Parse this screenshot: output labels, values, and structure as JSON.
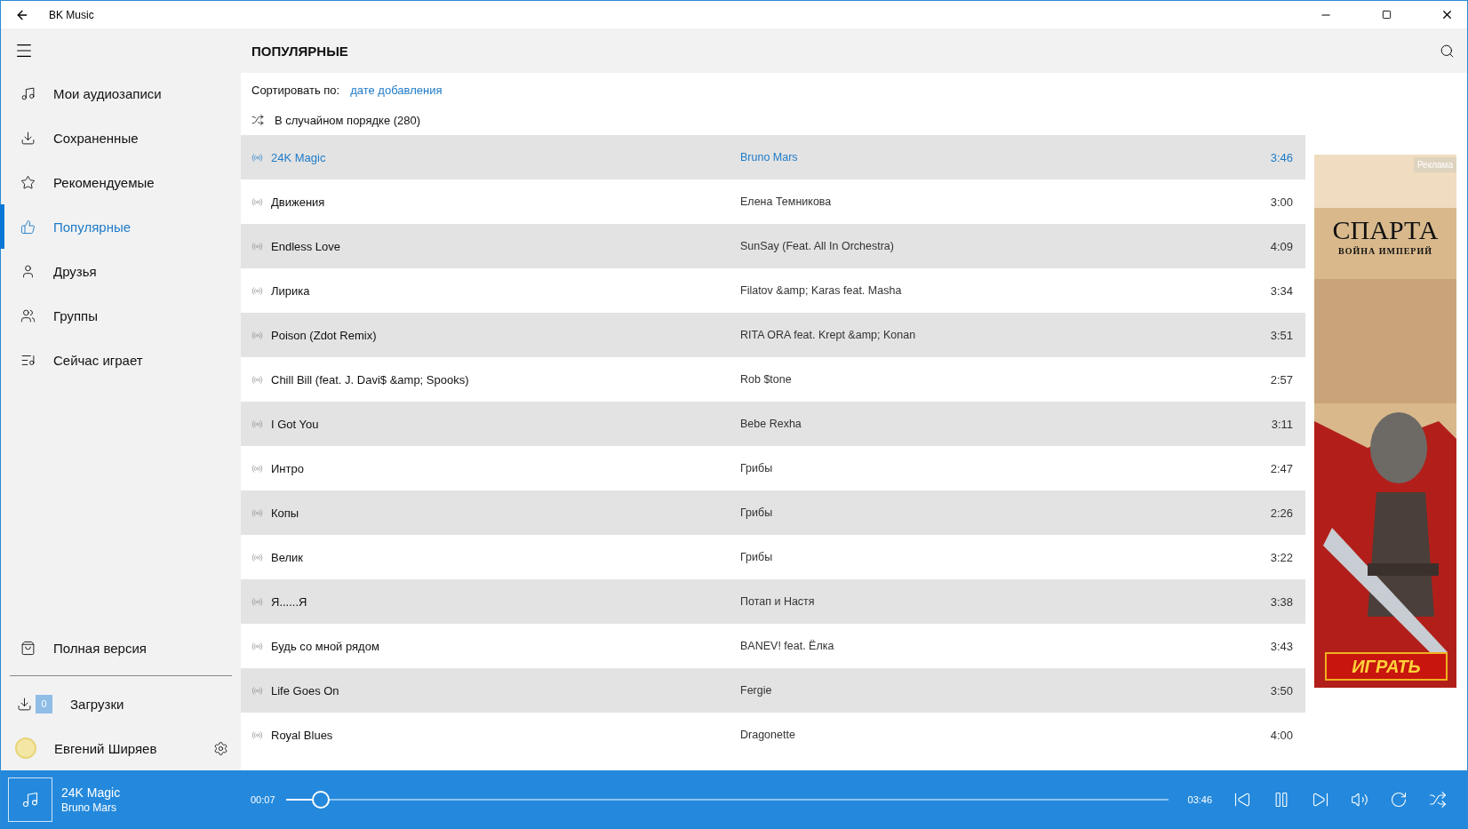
{
  "window": {
    "title": "BK Music"
  },
  "sidebar": {
    "items": [
      {
        "label": "Мои аудиозаписи",
        "kind": "music",
        "selected": false
      },
      {
        "label": "Сохраненные",
        "kind": "download",
        "selected": false
      },
      {
        "label": "Рекомендуемые",
        "kind": "star",
        "selected": false
      },
      {
        "label": "Популярные",
        "kind": "like",
        "selected": true
      },
      {
        "label": "Друзья",
        "kind": "user",
        "selected": false
      },
      {
        "label": "Группы",
        "kind": "group",
        "selected": false
      },
      {
        "label": "Сейчас играет",
        "kind": "queue",
        "selected": false
      }
    ],
    "full_version": "Полная версия",
    "downloads": {
      "count": "0",
      "label": "Загрузки"
    },
    "user": {
      "name": "Евгений Ширяев"
    }
  },
  "header": {
    "title": "ПОПУЛЯРНЫЕ"
  },
  "sort": {
    "label": "Сортировать по:",
    "value": "дате добавления"
  },
  "shuffle": {
    "label": "В случайном порядке (280)"
  },
  "tracks": [
    {
      "title": "24K Magic",
      "artist": "Bruno Mars",
      "duration": "3:46",
      "selected": true
    },
    {
      "title": "Движения",
      "artist": "Елена Темникова",
      "duration": "3:00",
      "selected": false
    },
    {
      "title": "Endless Love",
      "artist": "SunSay (Feat. All In Orchestra)",
      "duration": "4:09",
      "selected": false
    },
    {
      "title": "Лирика",
      "artist": "Filatov &amp; Karas feat. Masha",
      "duration": "3:34",
      "selected": false
    },
    {
      "title": "Poison (Zdot Remix)",
      "artist": "RITA ORA feat. Krept &amp; Konan",
      "duration": "3:51",
      "selected": false
    },
    {
      "title": "Chill Bill (feat. J. Davi$ &amp; Spooks)",
      "artist": "Rob $tone",
      "duration": "2:57",
      "selected": false
    },
    {
      "title": "I Got You",
      "artist": "Bebe Rexha",
      "duration": "3:11",
      "selected": false
    },
    {
      "title": "Интро",
      "artist": "Грибы",
      "duration": "2:47",
      "selected": false
    },
    {
      "title": "Копы",
      "artist": "Грибы",
      "duration": "2:26",
      "selected": false
    },
    {
      "title": "Велик",
      "artist": "Грибы",
      "duration": "3:22",
      "selected": false
    },
    {
      "title": "Я......Я",
      "artist": "Потап и Настя",
      "duration": "3:38",
      "selected": false
    },
    {
      "title": "Будь со мной рядом",
      "artist": "BANEV! feat. Ёлка",
      "duration": "3:43",
      "selected": false
    },
    {
      "title": "Life Goes On",
      "artist": "Fergie",
      "duration": "3:50",
      "selected": false
    },
    {
      "title": "Royal Blues",
      "artist": "Dragonette",
      "duration": "4:00",
      "selected": false
    }
  ],
  "ad": {
    "badge": "Реклама",
    "title": "СПАРТА",
    "subtitle": "ВОЙНА ИМПЕРИЙ",
    "button": "ИГРАТЬ"
  },
  "player": {
    "title": "24K Magic",
    "artist": "Bruno Mars",
    "elapsed": "00:07",
    "total": "03:46",
    "level": 0.04
  }
}
